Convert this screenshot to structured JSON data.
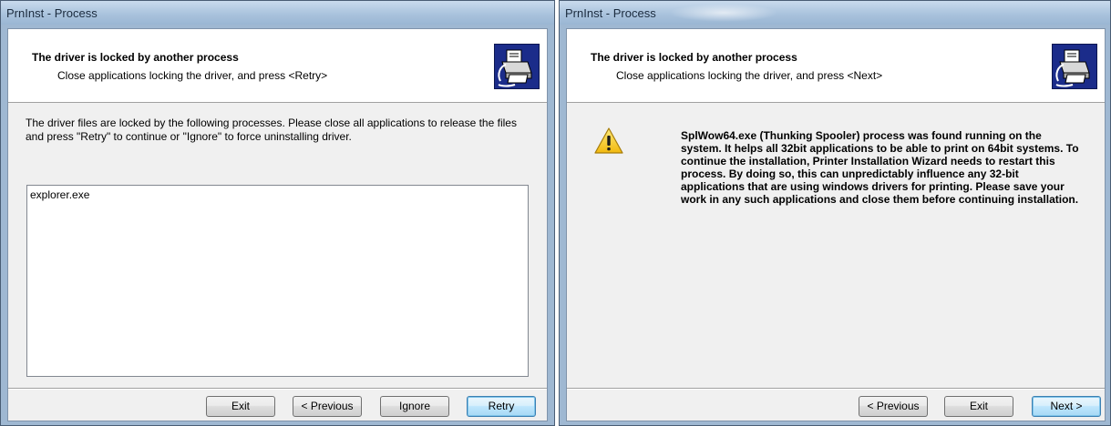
{
  "left_window": {
    "title": "PrnInst - Process",
    "header_title": "The driver is locked by another process",
    "header_subtitle": "Close applications locking the driver, and press <Retry>",
    "header_icon": "printer-wizard-icon",
    "description": "The driver files are locked by the following processes. Please close all applications to release the files and press \"Retry\" to continue or \"Ignore\" to force uninstalling driver.",
    "processes": [
      "explorer.exe"
    ],
    "buttons": {
      "exit": "Exit",
      "previous": "< Previous",
      "ignore": "Ignore",
      "retry": "Retry"
    }
  },
  "right_window": {
    "title": "PrnInst - Process",
    "header_title": "The driver is locked by another process",
    "header_subtitle": "Close applications locking the driver, and press <Next>",
    "header_icon": "printer-wizard-icon",
    "warning_icon": "warning-icon",
    "message": "SplWow64.exe (Thunking Spooler) process was found running on the system. It helps all 32bit applications to be able to print on 64bit systems. To continue the installation, Printer Installation Wizard needs to restart this process. By doing so, this can unpredictably influence any 32-bit applications that are using windows drivers for printing. Please save your work in any such applications and close them before continuing installation.",
    "buttons": {
      "previous": "< Previous",
      "exit": "Exit",
      "next": "Next >"
    }
  },
  "colors": {
    "window_frame": "#9fb8d2",
    "dialog_bg": "#f0f0f0",
    "header_bg": "#ffffff",
    "default_button_border": "#3c7fb1",
    "icon_blue": "#1b2c8a"
  }
}
